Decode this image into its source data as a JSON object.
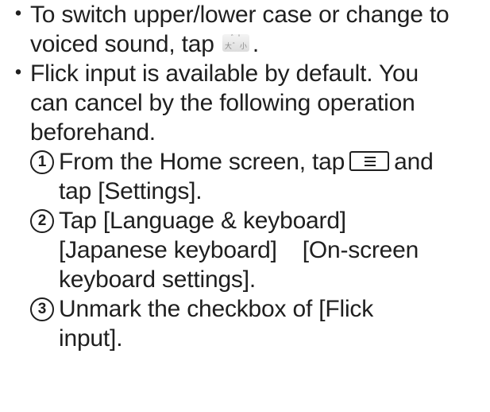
{
  "bullet_char": "・",
  "bullets": [
    {
      "lines": [
        "To switch upper/lower case or change to",
        "voiced sound, tap"
      ],
      "after_icon": "."
    },
    {
      "lines": [
        "Flick input is available by default. You",
        "can cancel by the following operation",
        "beforehand."
      ]
    }
  ],
  "steps": [
    {
      "number": "1",
      "lines": [
        "From the Home screen, tap",
        "and",
        "tap [Settings]."
      ]
    },
    {
      "number": "2",
      "lines": [
        "Tap [Language & keyboard]",
        "[Japanese keyboard]",
        "[On-screen",
        "keyboard settings]."
      ]
    },
    {
      "number": "3",
      "lines": [
        "Unmark the checkbox of [Flick",
        "input]."
      ]
    }
  ],
  "icons": {
    "case_key": "case-voiced-toggle-key-icon",
    "menu_key": "menu-key-icon"
  }
}
